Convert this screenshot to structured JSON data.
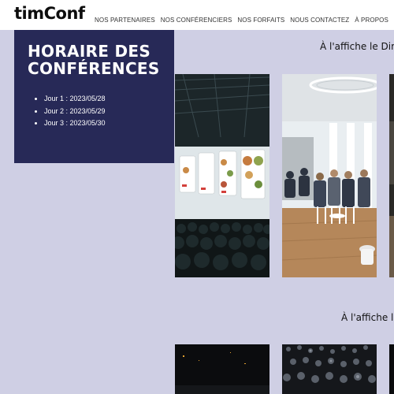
{
  "header": {
    "logo": "timConf",
    "nav": [
      {
        "label": "NOS PARTENAIRES",
        "name": "nav-partenaires"
      },
      {
        "label": "NOS CONFÉRENCIERS",
        "name": "nav-conferenciers"
      },
      {
        "label": "NOS FORFAITS",
        "name": "nav-forfaits"
      },
      {
        "label": "NOUS CONTACTEZ",
        "name": "nav-contact"
      },
      {
        "label": "À PROPOS",
        "name": "nav-a-propos"
      }
    ]
  },
  "schedule": {
    "title": "HORAIRE DES CONFÉRENCES",
    "days": [
      "Jour 1 : 2023/05/28",
      "Jour 2 : 2023/05/29",
      "Jour 3 : 2023/05/30"
    ]
  },
  "sections": [
    {
      "title": "À l'affiche le Dim"
    },
    {
      "title": "À l'affiche le"
    }
  ],
  "colors": {
    "page_background": "#cfcfe4",
    "schedule_background": "#272957",
    "header_background": "#ffffff"
  }
}
